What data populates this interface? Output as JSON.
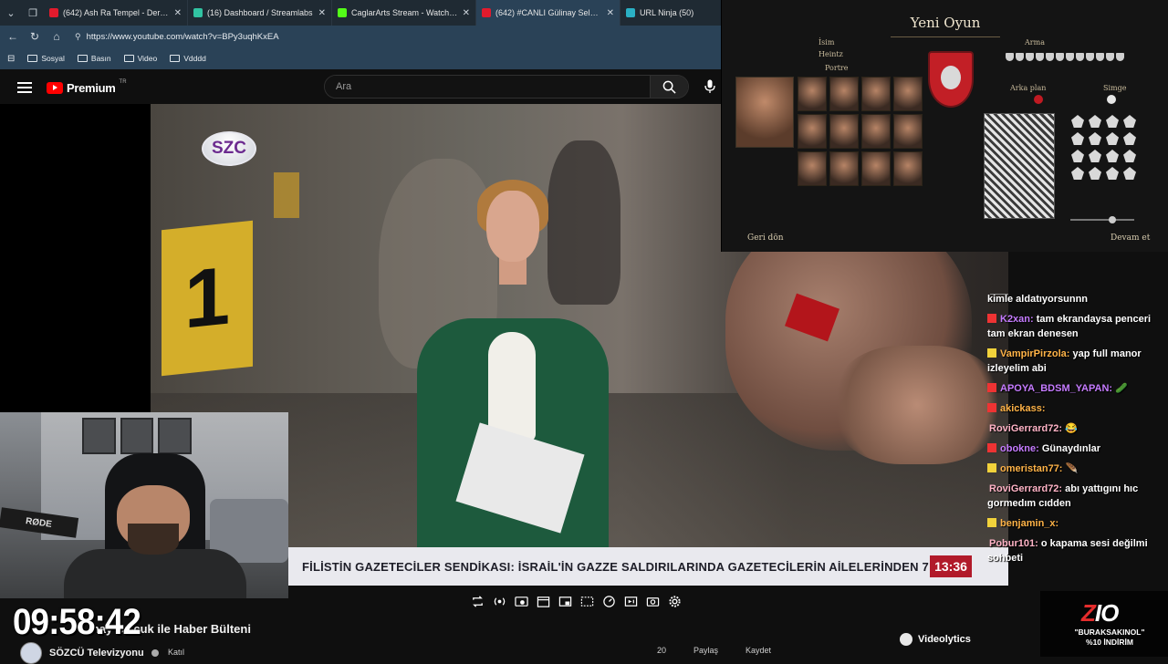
{
  "browser": {
    "tabs": [
      {
        "title": "(642) Ash Ra Tempel - Der Vierte R",
        "favicon_color": "#e21b2d",
        "active": false
      },
      {
        "title": "(16) Dashboard / Streamlabs",
        "favicon_color": "#31c3a2",
        "active": false
      },
      {
        "title": "CaglarArts Stream - Watch Live on",
        "favicon_color": "#53fc18",
        "active": false
      },
      {
        "title": "(642) #CANLI Gülinay Selçuk ile",
        "favicon_color": "#e21b2d",
        "active": true
      },
      {
        "title": "URL Ninja (50)",
        "favicon_color": "#2ab0c4",
        "active": false
      }
    ],
    "url": "https://www.youtube.com/watch?v=BPy3uqhKxEA",
    "bookmarks": [
      "Sosyal",
      "Basın",
      "Video",
      "Vdddd"
    ]
  },
  "youtube": {
    "brand": "Premium",
    "brand_region": "TR",
    "search_placeholder": "Ara",
    "video_title": "...nay Selçuk ile Haber Bülteni",
    "channel_name": "SÖZCÜ Televizyonu",
    "subscribe_label": "Katıl",
    "actions": [
      "20",
      "Paylaş",
      "Kaydet"
    ]
  },
  "video": {
    "channel_logo": "SZC",
    "evidence_marker": "1",
    "ticker_text": "FİLİSTİN GAZETECİLER SENDİKASI: İSRAİL'İN GAZZE SALDIRILARINDA GAZETECİLERİN AİLELERİNDEN 7",
    "ticker_time": "13:36"
  },
  "stream_overlay": {
    "clock": "09:58:42",
    "webcam_mic_label": "RØDE",
    "videolytics_label": "Videolytics",
    "sponsor_brand_a": "Z",
    "sponsor_brand_b": "IO",
    "sponsor_line1": "\"BURAKSAKINOL\"",
    "sponsor_line2": "%10 İNDİRİM"
  },
  "chat": [
    {
      "user": "",
      "message": "kimle aldatıyorsunnn",
      "color": "#ffffff",
      "badge": ""
    },
    {
      "user": "K2xan",
      "message": "tam ekrandaysa penceri tam ekran denesen",
      "color": "#c57bff",
      "badge": "#e33"
    },
    {
      "user": "VampirPirzola",
      "message": "yap full manor izleyelim abi",
      "color": "#ffb347",
      "badge": "#f2d23b"
    },
    {
      "user": "APOYA_BDSM_YAPAN",
      "message": "🥒",
      "color": "#c57bff",
      "badge": "#e33"
    },
    {
      "user": "akickass",
      "message": "",
      "color": "#ffb347",
      "badge": "#e33"
    },
    {
      "user": "RoviGerrard72",
      "message": "😂",
      "color": "#ffb3c6",
      "badge": ""
    },
    {
      "user": "obokne",
      "message": "Günaydınlar",
      "color": "#c57bff",
      "badge": "#e33"
    },
    {
      "user": "omeristan77",
      "message": "🪶",
      "color": "#ffb347",
      "badge": "#f2d23b"
    },
    {
      "user": "RoviGerrard72",
      "message": "abı yattıgını hıc gormedım cıdden",
      "color": "#ffb3c6",
      "badge": ""
    },
    {
      "user": "benjamin_x",
      "message": "",
      "color": "#ffb347",
      "badge": "#f2d23b"
    },
    {
      "user": "Pobur101",
      "message": "o kapama sesi değilmi sohbeti",
      "color": "#ffb3c6",
      "badge": ""
    }
  ],
  "game": {
    "title": "Yeni Oyun",
    "name_label": "İsim",
    "name_value": "Heintz",
    "portrait_label": "Portre",
    "arms_label": "Arma",
    "background_label": "Arka plan",
    "charge_label": "Simge",
    "back_label": "Geri dön",
    "continue_label": "Devam et",
    "shield_color": "#c21f26"
  }
}
